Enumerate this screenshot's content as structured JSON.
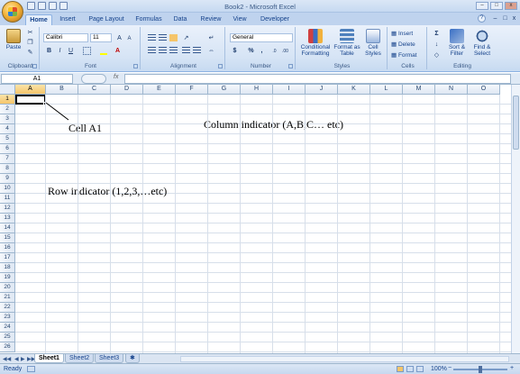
{
  "window": {
    "title": "Book2 - Microsoft Excel",
    "controls": [
      "–",
      "□",
      "x"
    ]
  },
  "tabs": [
    "Home",
    "Insert",
    "Page Layout",
    "Formulas",
    "Data",
    "Review",
    "View",
    "Developer"
  ],
  "ribbon": {
    "clipboard": {
      "label": "Clipboard",
      "paste": "Paste"
    },
    "font": {
      "label": "Font",
      "font_name": "Calibri",
      "font_size": "11",
      "bold": "B",
      "italic": "I",
      "underline": "U"
    },
    "alignment": {
      "label": "Alignment"
    },
    "number": {
      "label": "Number",
      "format": "General",
      "currency": "$",
      "percent": "%",
      "comma": ","
    },
    "styles": {
      "label": "Styles",
      "conditional": "Conditional Formatting",
      "format_table": "Format as Table",
      "cell_styles": "Cell Styles"
    },
    "cells": {
      "label": "Cells",
      "insert": "Insert",
      "delete": "Delete",
      "format": "Format"
    },
    "editing": {
      "label": "Editing",
      "sort_filter": "Sort & Filter",
      "find_select": "Find & Select"
    }
  },
  "formula_bar": {
    "name_box": "A1",
    "fx": "fx",
    "value": ""
  },
  "grid": {
    "columns": [
      "A",
      "B",
      "C",
      "D",
      "E",
      "F",
      "G",
      "H",
      "I",
      "J",
      "K",
      "L",
      "M",
      "N",
      "O"
    ],
    "rows": [
      "1",
      "2",
      "3",
      "4",
      "5",
      "6",
      "7",
      "8",
      "9",
      "10",
      "11",
      "12",
      "13",
      "14",
      "15",
      "16",
      "17",
      "18",
      "19",
      "20",
      "21",
      "22",
      "23",
      "24",
      "25",
      "26"
    ],
    "active_cell": "A1"
  },
  "annotations": {
    "cell": "Cell A1",
    "column": "Column indicator (A,B,C… etc)",
    "row": "Row indicator (1,2,3,…etc)"
  },
  "sheets": [
    "Sheet1",
    "Sheet2",
    "Sheet3"
  ],
  "status": {
    "ready": "Ready",
    "zoom": "100%"
  },
  "colors": {
    "ribbon_bg": "#d6e4f5",
    "accent": "#15428b",
    "header_selected": "#f5c56a"
  }
}
